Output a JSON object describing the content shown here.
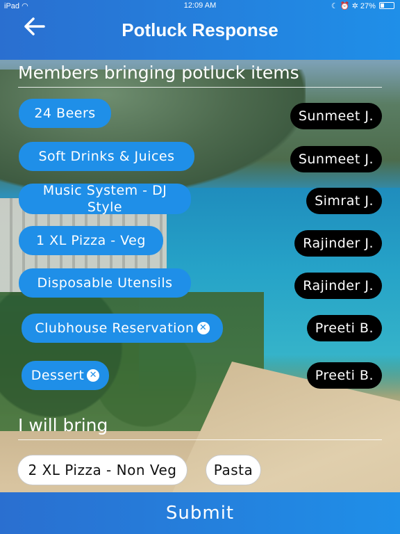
{
  "status_bar": {
    "device": "iPad",
    "time": "12:09 AM",
    "battery": "27%"
  },
  "header": {
    "title": "Potluck Response",
    "back_icon": "arrow-left-icon"
  },
  "members_section": {
    "title": "Members bringing potluck items",
    "rows": [
      {
        "item": "24 Beers",
        "member": "Sunmeet J.",
        "removable": false
      },
      {
        "item": "Soft Drinks & Juices",
        "member": "Sunmeet J.",
        "removable": false
      },
      {
        "item": "Music System - DJ Style",
        "member": "Simrat J.",
        "removable": false
      },
      {
        "item": "1 XL Pizza - Veg",
        "member": "Rajinder J.",
        "removable": false
      },
      {
        "item": "Disposable Utensils",
        "member": "Rajinder J.",
        "removable": false
      },
      {
        "item": "Clubhouse Reservation",
        "member": "Preeti B.",
        "removable": true
      },
      {
        "item": "Dessert",
        "member": "Preeti B.",
        "removable": true
      }
    ]
  },
  "bring_section": {
    "title": "I will bring",
    "items": [
      "2 XL Pizza - Non Veg",
      "Pasta"
    ]
  },
  "submit": {
    "label": "Submit"
  },
  "colors": {
    "accent": "#1f8fe8",
    "header": "#2a6fd0",
    "member_pill": "#000000"
  }
}
